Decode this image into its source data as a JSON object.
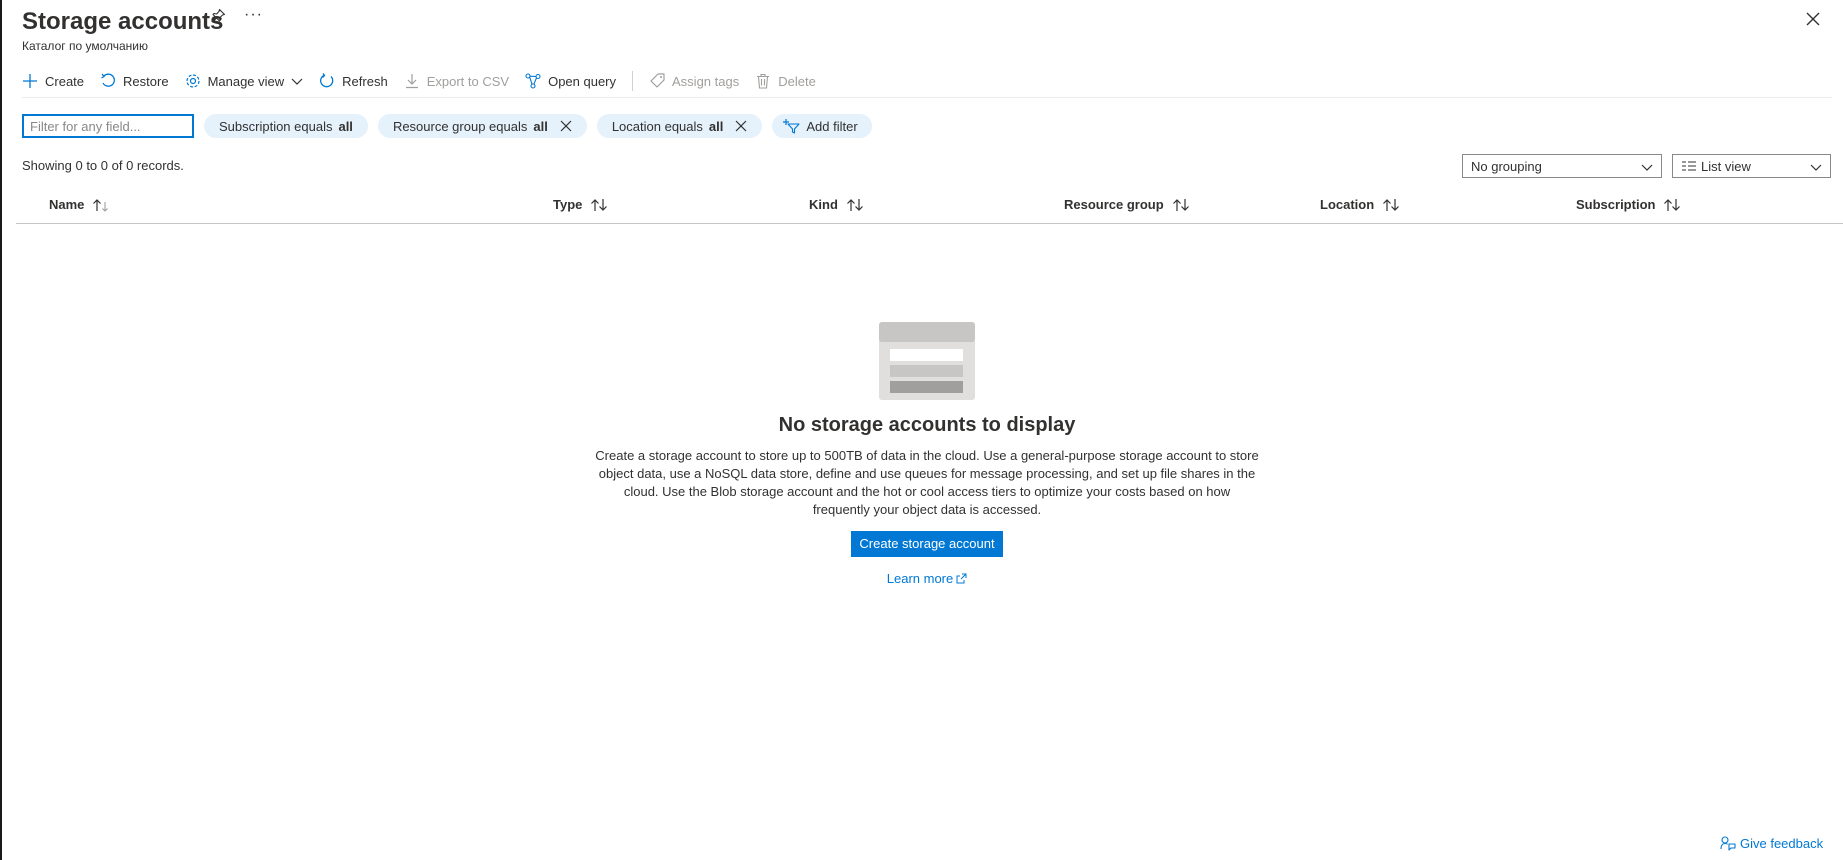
{
  "header": {
    "title": "Storage accounts",
    "subtitle": "Каталог по умолчанию",
    "more_label": "···"
  },
  "toolbar": {
    "create": "Create",
    "restore": "Restore",
    "manage_view": "Manage view",
    "refresh": "Refresh",
    "export_csv": "Export to CSV",
    "open_query": "Open query",
    "assign_tags": "Assign tags",
    "delete": "Delete"
  },
  "filters": {
    "search_placeholder": "Filter for any field...",
    "subscription": {
      "label": "Subscription equals ",
      "value": "all"
    },
    "resource_group": {
      "label": "Resource group equals ",
      "value": "all"
    },
    "location": {
      "label": "Location equals ",
      "value": "all"
    },
    "add_filter": "Add filter"
  },
  "records": "Showing 0 to 0 of 0 records.",
  "grouping": {
    "selected": "No grouping"
  },
  "view": {
    "selected": "List view"
  },
  "columns": {
    "name": "Name",
    "type": "Type",
    "kind": "Kind",
    "resource_group": "Resource group",
    "location": "Location",
    "subscription": "Subscription"
  },
  "empty": {
    "title": "No storage accounts to display",
    "description": "Create a storage account to store up to 500TB of data in the cloud. Use a general-purpose storage account to store object data, use a NoSQL data store, define and use queues for message processing, and set up file shares in the cloud. Use the Blob storage account and the hot or cool access tiers to optimize your costs based on how frequently your object data is accessed.",
    "button": "Create storage account",
    "learn_more": "Learn more"
  },
  "feedback": "Give feedback",
  "colors": {
    "accent": "#0078d4",
    "pill_bg": "#e5f1fb",
    "disabled": "#a19f9d"
  }
}
